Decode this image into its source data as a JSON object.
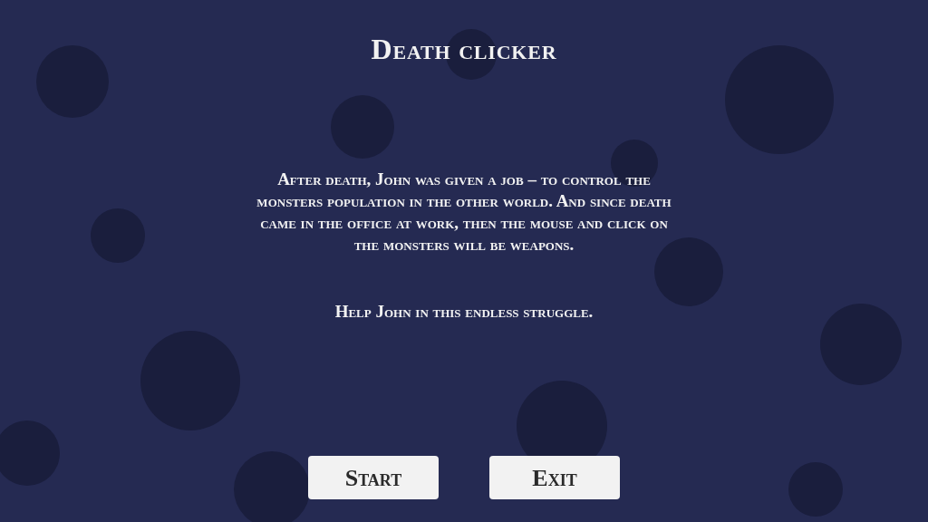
{
  "title": "Death clicker",
  "story": "After death, John was given a job – to control the monsters population in the other world. And since death came in the office at work, then the mouse and click on the monsters will be weapons.",
  "call_to_action": "Help John in this endless struggle.",
  "buttons": [
    "Start",
    "Exit"
  ]
}
